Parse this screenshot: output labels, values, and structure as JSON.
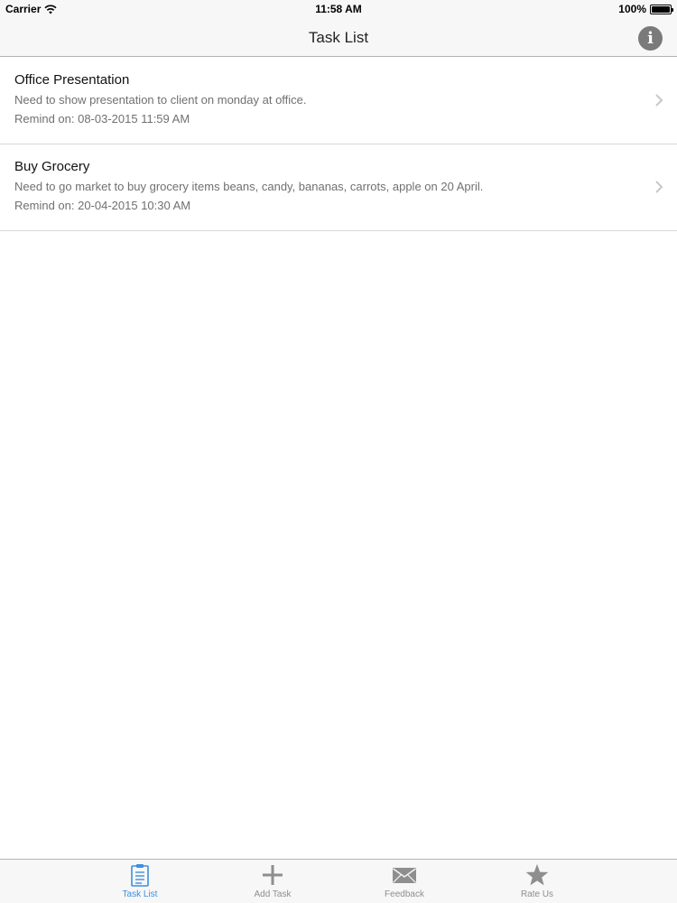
{
  "status_bar": {
    "carrier": "Carrier",
    "time": "11:58 AM",
    "battery": "100%"
  },
  "nav": {
    "title": "Task List",
    "info_icon": "info-icon"
  },
  "tasks": [
    {
      "title": "Office Presentation",
      "description": "Need to show presentation to client on monday at office.",
      "remind": "Remind on: 08-03-2015 11:59 AM"
    },
    {
      "title": "Buy Grocery",
      "description": "Need to go market to buy grocery items beans, candy, bananas, carrots, apple on 20 April.",
      "remind": "Remind on: 20-04-2015 10:30 AM"
    }
  ],
  "tab_bar": {
    "active_color": "#3d8fe0",
    "inactive_color": "#8e8e8e",
    "tabs": [
      {
        "label": "Task List",
        "icon": "clipboard-icon",
        "active": true
      },
      {
        "label": "Add Task",
        "icon": "plus-icon",
        "active": false
      },
      {
        "label": "Feedback",
        "icon": "envelope-icon",
        "active": false
      },
      {
        "label": "Rate Us",
        "icon": "star-icon",
        "active": false
      }
    ]
  }
}
